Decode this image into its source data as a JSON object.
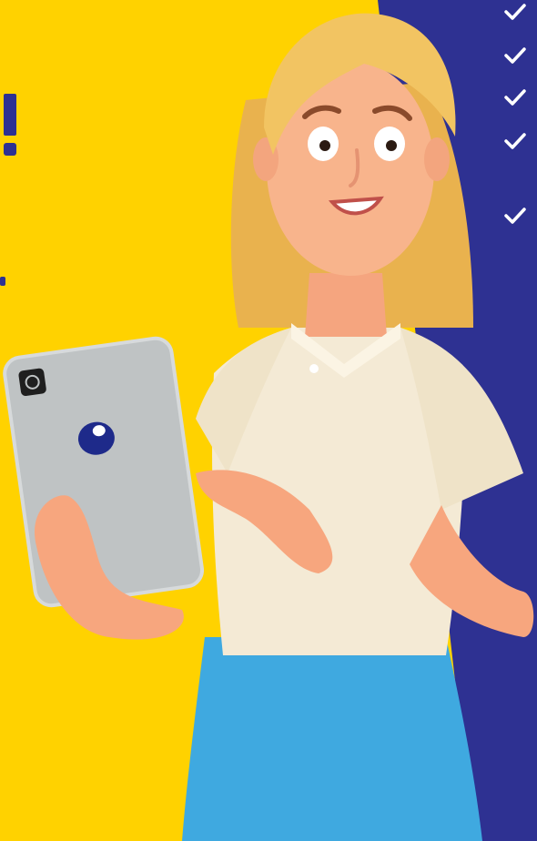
{
  "colors": {
    "yellow": "#FFD200",
    "navy": "#2E3192",
    "check": "#FFFFFF",
    "hair": "#F2C462",
    "skin": "#F8B48C",
    "blouse": "#F4EAD5",
    "skirt": "#3FA9E0",
    "tablet": "#BFC3C4",
    "logo": "#1E2A8A"
  },
  "checklist": {
    "items": [
      {
        "icon": "check-icon"
      },
      {
        "icon": "check-icon"
      },
      {
        "icon": "check-icon"
      },
      {
        "icon": "check-icon"
      },
      {
        "icon": "check-icon"
      }
    ]
  },
  "illustration": {
    "subject": "woman-holding-tablet",
    "tablet_logo": "brand-logo-icon",
    "camera": "camera-icon"
  }
}
